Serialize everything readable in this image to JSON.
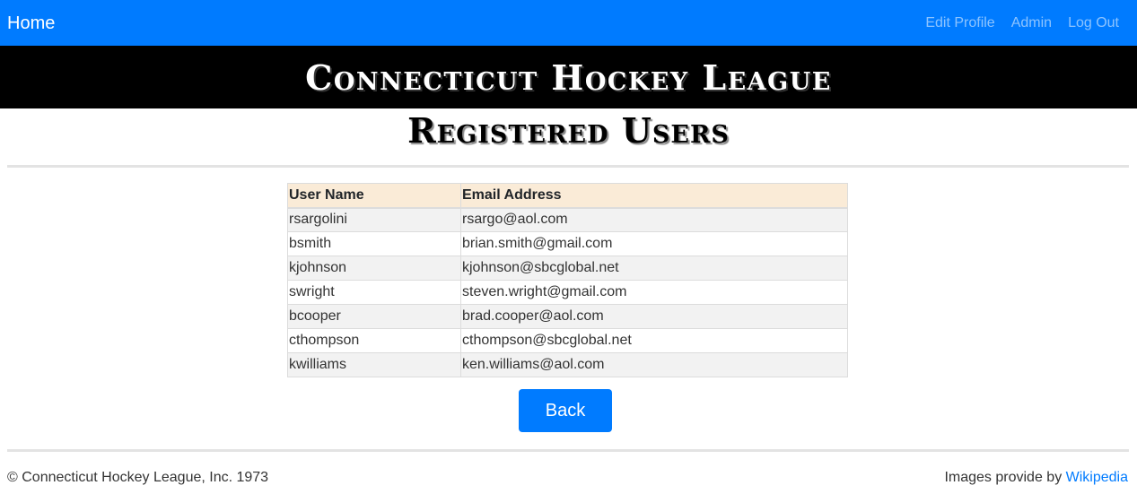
{
  "navbar": {
    "brand": "Home",
    "links": [
      "Edit Profile",
      "Admin",
      "Log Out"
    ]
  },
  "banner": {
    "title": "Connecticut Hockey League"
  },
  "page": {
    "title": "Registered Users"
  },
  "table": {
    "headers": [
      "User Name",
      "Email Address"
    ],
    "rows": [
      [
        "rsargolini",
        "rsargo@aol.com"
      ],
      [
        "bsmith",
        "brian.smith@gmail.com"
      ],
      [
        "kjohnson",
        "kjohnson@sbcglobal.net"
      ],
      [
        "swright",
        "steven.wright@gmail.com"
      ],
      [
        "bcooper",
        "brad.cooper@aol.com"
      ],
      [
        "cthompson",
        "cthompson@sbcglobal.net"
      ],
      [
        "kwilliams",
        "ken.williams@aol.com"
      ]
    ]
  },
  "actions": {
    "back_label": "Back"
  },
  "footer": {
    "copyright": "© Connecticut Hockey League, Inc. 1973",
    "credit_prefix": "Images provide by ",
    "credit_link": "Wikipedia"
  },
  "colors": {
    "primary": "#007bff",
    "banner_bg": "#000000",
    "table_header_bg": "#faebd7",
    "row_stripe": "#f2f2f2"
  }
}
